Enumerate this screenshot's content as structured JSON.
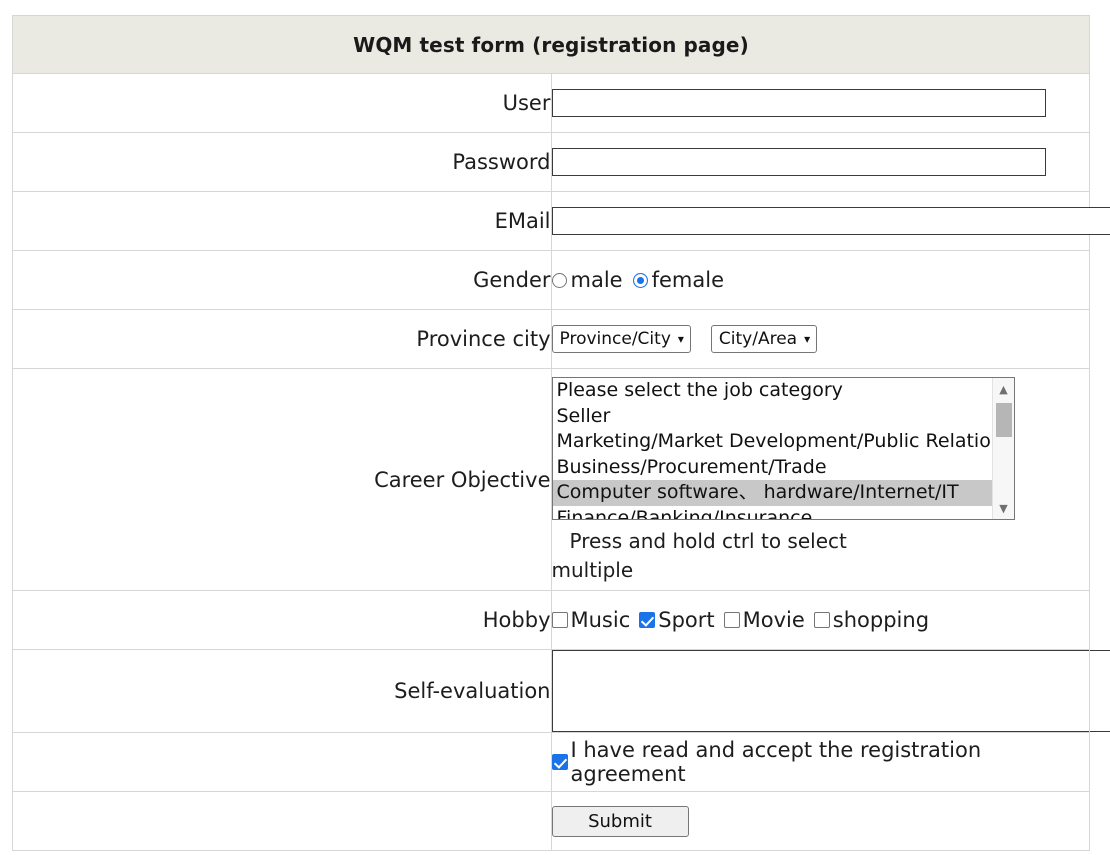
{
  "form": {
    "title": "WQM test form (registration page)",
    "rows": {
      "user": {
        "label": "User",
        "value": "",
        "placeholder": ""
      },
      "password": {
        "label": "Password",
        "value": "",
        "placeholder": ""
      },
      "email": {
        "label": "EMail",
        "value": "",
        "placeholder": ""
      },
      "gender": {
        "label": "Gender",
        "options": [
          {
            "label": "male",
            "checked": false
          },
          {
            "label": "female",
            "checked": true
          }
        ]
      },
      "province_city": {
        "label": "Province city",
        "selects": [
          {
            "name": "province-select",
            "value": "Province/City"
          },
          {
            "name": "city-select",
            "value": "City/Area"
          }
        ]
      },
      "career": {
        "label": "Career Objective",
        "hint_line1": "Press and hold ctrl to select",
        "hint_line2": "multiple",
        "options": [
          {
            "label": "Please select the job category",
            "selected": false
          },
          {
            "label": "Seller",
            "selected": false
          },
          {
            "label": "Marketing/Market Development/Public Relations",
            "selected": false
          },
          {
            "label": "Business/Procurement/Trade",
            "selected": false
          },
          {
            "label": "Computer software、 hardware/Internet/IT",
            "selected": true
          },
          {
            "label": "Finance/Banking/Insurance",
            "selected": false
          }
        ],
        "scrollbar": {
          "up_arrow": "scroll-up-arrow",
          "down_arrow": "scroll-down-arrow"
        }
      },
      "hobby": {
        "label": "Hobby",
        "options": [
          {
            "label": "Music",
            "checked": false
          },
          {
            "label": "Sport",
            "checked": true
          },
          {
            "label": "Movie",
            "checked": false
          },
          {
            "label": "shopping",
            "checked": false
          }
        ]
      },
      "self_evaluation": {
        "label": "Self-evaluation",
        "value": "",
        "placeholder": ""
      },
      "agreement": {
        "label": "I have read and accept the registration agreement",
        "checked": true
      },
      "submit": {
        "label": "Submit"
      }
    }
  },
  "icons": {
    "chevron_down": "⌄",
    "triangle_up": "▲",
    "triangle_down": "▼"
  },
  "colors": {
    "header_bg": "#eaeae2",
    "border": "#d6d6d6",
    "accent": "#1a73e8",
    "selected_option_bg": "#c8c8c8",
    "text": "#1d1d1d"
  }
}
